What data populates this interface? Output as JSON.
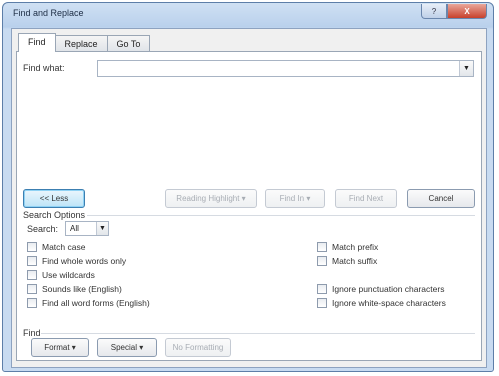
{
  "window": {
    "title": "Find and Replace",
    "help": "?",
    "close": "X"
  },
  "tabs": [
    {
      "label": "Find"
    },
    {
      "label": "Replace"
    },
    {
      "label": "Go To"
    }
  ],
  "find": {
    "label": "Find what:",
    "value": ""
  },
  "buttons": {
    "less": "<< Less",
    "reading_highlight": "Reading Highlight ▾",
    "find_in": "Find In ▾",
    "find_next": "Find Next",
    "cancel": "Cancel"
  },
  "options": {
    "title": "Search Options",
    "search_label": "Search:",
    "search_value": "All",
    "left": [
      {
        "label": "Match case"
      },
      {
        "label": "Find whole words only"
      },
      {
        "label": "Use wildcards"
      },
      {
        "label": "Sounds like (English)"
      },
      {
        "label": "Find all word forms (English)"
      }
    ],
    "right": [
      {
        "label": "Match prefix"
      },
      {
        "label": "Match suffix"
      },
      {
        "label": "Ignore punctuation characters"
      },
      {
        "label": "Ignore white-space characters"
      }
    ]
  },
  "find_section": {
    "title": "Find",
    "format": "Format ▾",
    "special": "Special ▾",
    "no_formatting": "No Formatting"
  }
}
